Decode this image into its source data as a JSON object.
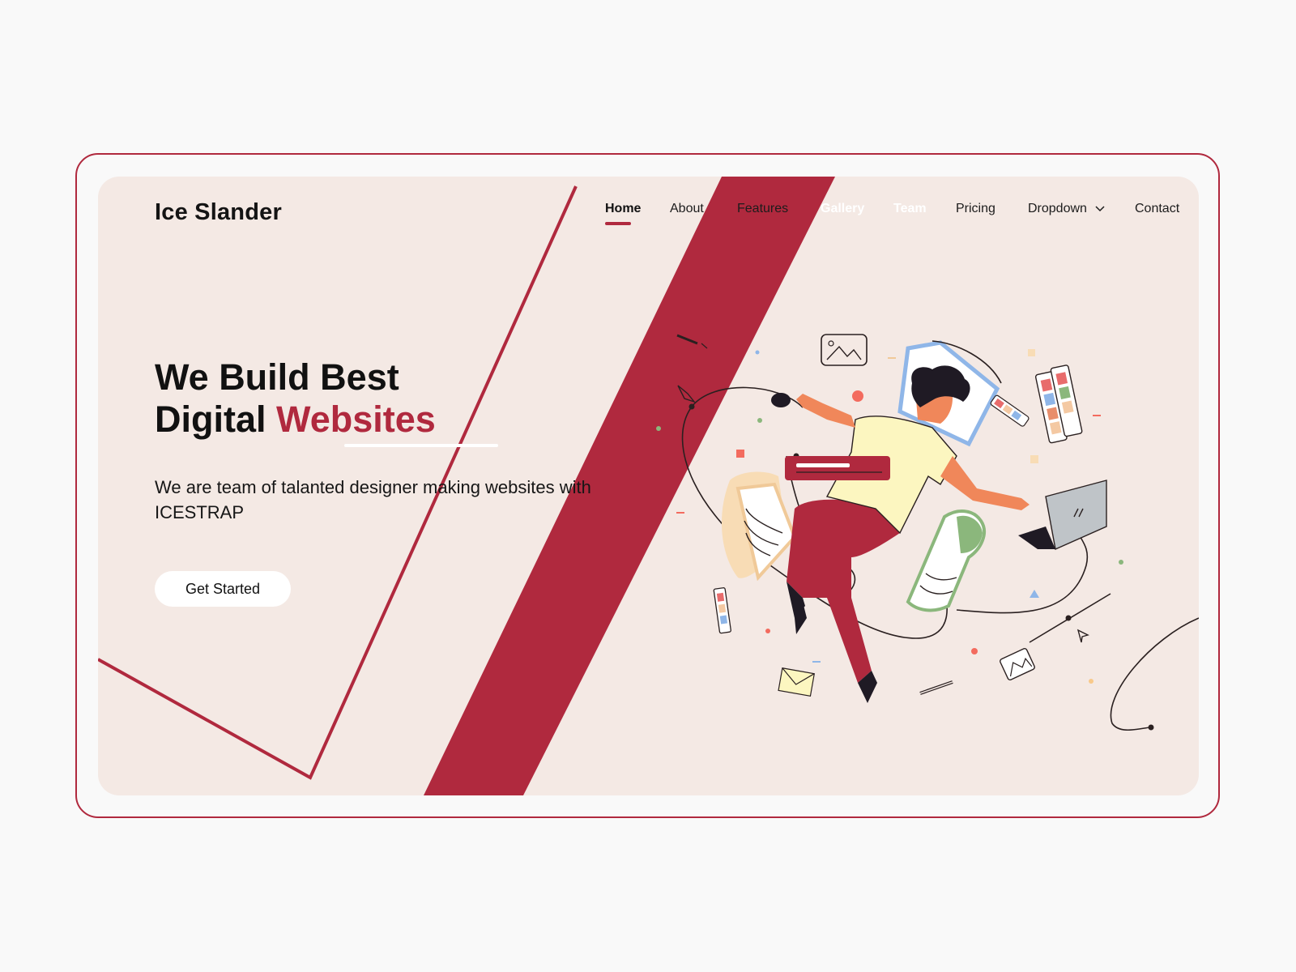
{
  "brand": {
    "name": "Ice Slander"
  },
  "nav": {
    "items": [
      {
        "label": "Home"
      },
      {
        "label": "About"
      },
      {
        "label": "Features"
      },
      {
        "label": "Gallery"
      },
      {
        "label": "Team"
      },
      {
        "label": "Pricing"
      },
      {
        "label": "Dropdown"
      },
      {
        "label": "Contact"
      }
    ],
    "active": "Home"
  },
  "hero": {
    "headline_line1": "We Build Best",
    "headline_line2_prefix": "Digital",
    "headline_accent": "Websites",
    "subtitle": "We are team of talanted designer making websites with ICESTRAP",
    "cta_label": "Get Started"
  },
  "colors": {
    "accent": "#b0293e",
    "card_background": "#f4e9e4",
    "page_background": "#f9f9f9"
  },
  "icons": [
    "chevron-down-icon"
  ]
}
